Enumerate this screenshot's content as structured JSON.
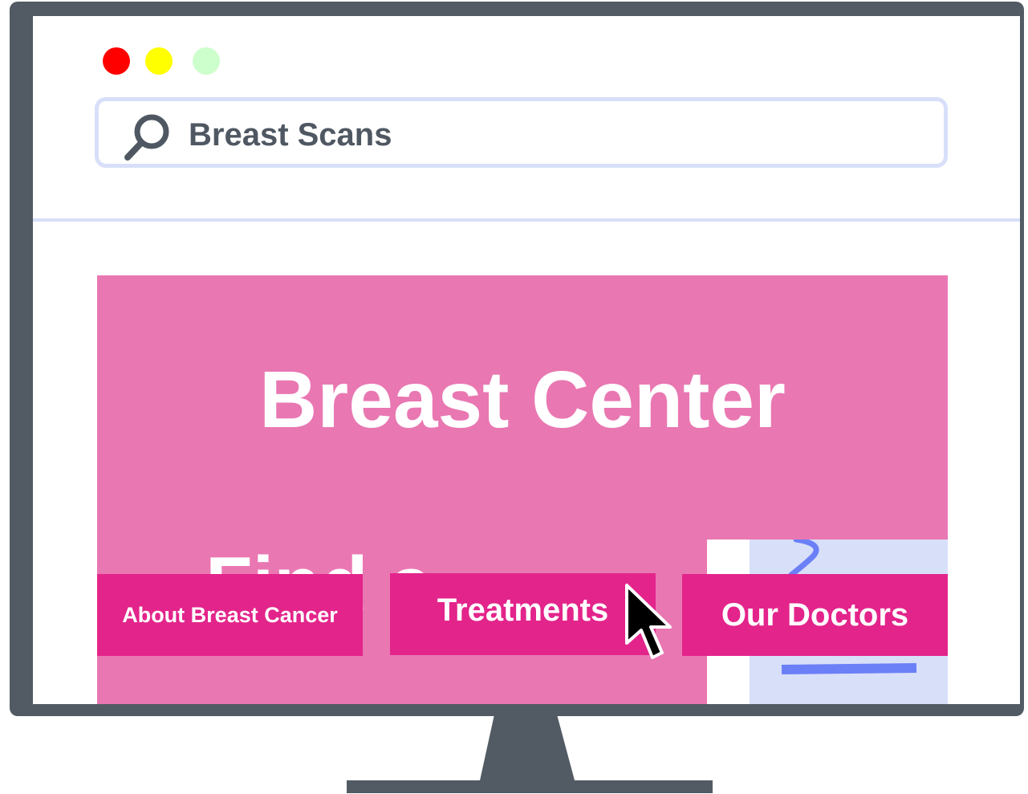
{
  "window": {
    "controls": [
      {
        "name": "close",
        "color": "#ff0000"
      },
      {
        "name": "minimize",
        "color": "#ffff00"
      },
      {
        "name": "maximize",
        "color": "#ccffcc"
      }
    ]
  },
  "search": {
    "icon": "search-icon",
    "value": "Breast Scans"
  },
  "page": {
    "title": "Breast Center",
    "partial_text": "Find a",
    "nav": [
      {
        "label": "About Breast Cancer"
      },
      {
        "label": "Treatments"
      },
      {
        "label": "Our Doctors"
      }
    ]
  },
  "colors": {
    "frame": "#525b64",
    "hero": "#e977b2",
    "button": "#e3248b",
    "search_border": "#d8dff9",
    "sketch": "#6b7ff7"
  },
  "cursor": "mouse-pointer-icon"
}
